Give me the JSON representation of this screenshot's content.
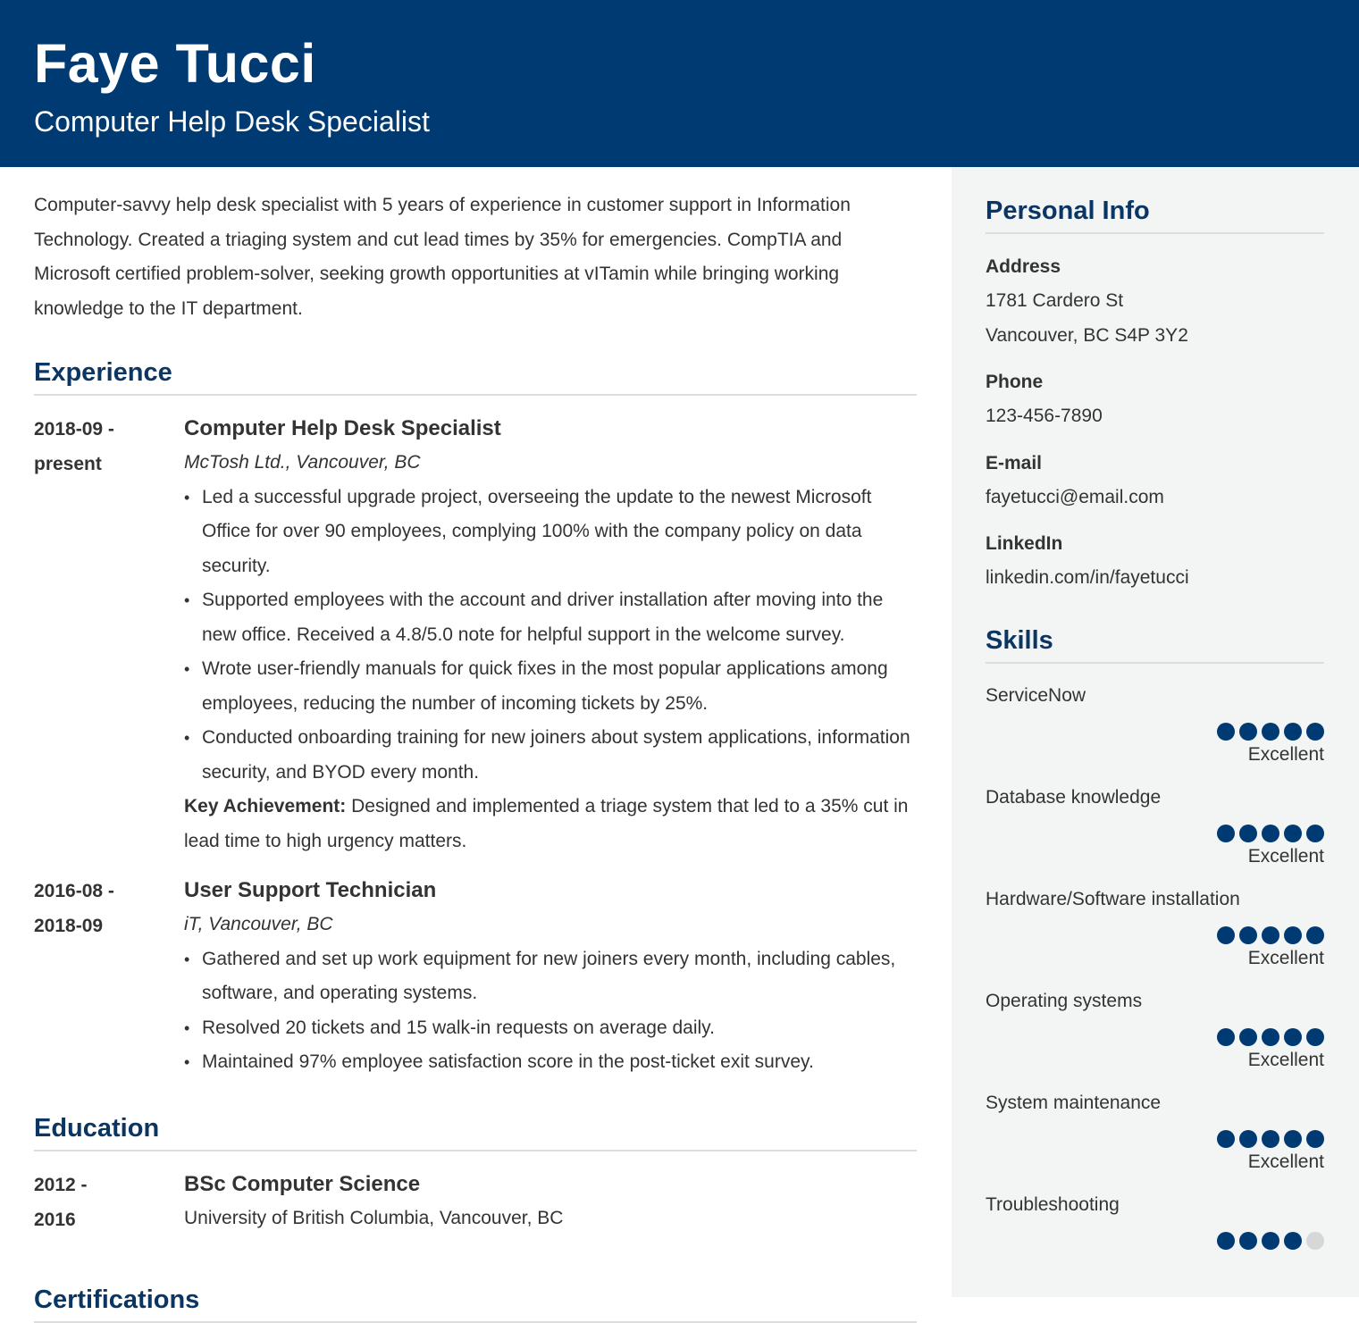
{
  "header": {
    "name": "Faye Tucci",
    "title": "Computer Help Desk Specialist"
  },
  "colors": {
    "primary": "#003a73",
    "heading": "#0b3663",
    "sidebar_bg": "#f3f4f4",
    "dot_inactive": "#d5d7d8"
  },
  "summary": "Computer-savvy help desk specialist with 5 years of experience in customer support in Information Technology. Created a triaging system and cut lead times by 35% for emergencies. CompTIA and Microsoft certified problem-solver, seeking growth opportunities at vITamin while bringing working knowledge to the IT department.",
  "experience": {
    "title": "Experience",
    "entries": [
      {
        "date_start": "2018-09 -",
        "date_end": "present",
        "role": "Computer Help Desk Specialist",
        "org": "McTosh Ltd., Vancouver, BC",
        "bullets": [
          "Led a successful upgrade project, overseeing the update to the newest Microsoft Office for over 90 employees, complying 100% with the company policy on data security.",
          "Supported employees with the account and driver installation after moving into the new office. Received a 4.8/5.0 note for helpful support in the welcome survey.",
          "Wrote user-friendly manuals for quick fixes in the most popular applications among employees, reducing the number of incoming tickets by 25%.",
          "Conducted onboarding training for new joiners about system applications, information security, and BYOD every month."
        ],
        "key_label": "Key Achievement:",
        "key_text": " Designed and implemented a triage system that led to a 35% cut in lead time to high urgency matters."
      },
      {
        "date_start": "2016-08 -",
        "date_end": "2018-09",
        "role": "User Support Technician",
        "org": "iT, Vancouver, BC",
        "bullets": [
          "Gathered and set up work equipment for new joiners every month, including cables, software, and operating systems.",
          "Resolved 20 tickets and 15 walk-in requests on average daily.",
          "Maintained 97% employee satisfaction score in the post-ticket exit survey."
        ]
      }
    ]
  },
  "education": {
    "title": "Education",
    "entries": [
      {
        "date_start": "2012 -",
        "date_end": "2016",
        "degree": "BSc Computer Science",
        "school": "University of British Columbia, Vancouver, BC"
      }
    ]
  },
  "certifications": {
    "title": "Certifications"
  },
  "personal_info": {
    "title": "Personal Info",
    "address_label": "Address",
    "address_line1": "1781 Cardero St",
    "address_line2": "Vancouver, BC S4P 3Y2",
    "phone_label": "Phone",
    "phone": "123-456-7890",
    "email_label": "E-mail",
    "email": "fayetucci@email.com",
    "linkedin_label": "LinkedIn",
    "linkedin": "linkedin.com/in/fayetucci"
  },
  "skills": {
    "title": "Skills",
    "max_level": 5,
    "items": [
      {
        "name": "ServiceNow",
        "level": 5,
        "label": "Excellent"
      },
      {
        "name": "Database knowledge",
        "level": 5,
        "label": "Excellent"
      },
      {
        "name": "Hardware/Software installation",
        "level": 5,
        "label": "Excellent"
      },
      {
        "name": "Operating systems",
        "level": 5,
        "label": "Excellent"
      },
      {
        "name": "System maintenance",
        "level": 5,
        "label": "Excellent"
      },
      {
        "name": "Troubleshooting",
        "level": 4,
        "label": ""
      }
    ]
  }
}
